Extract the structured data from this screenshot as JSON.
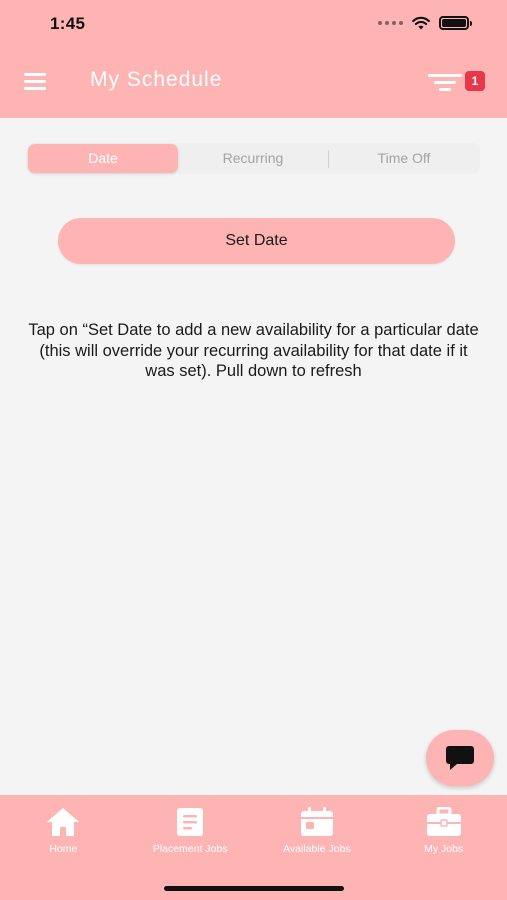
{
  "status_bar": {
    "time": "1:45"
  },
  "header": {
    "title": "My Schedule",
    "notification_count": "1"
  },
  "tabs": [
    {
      "label": "Date",
      "active": true
    },
    {
      "label": "Recurring",
      "active": false
    },
    {
      "label": "Time Off",
      "active": false
    }
  ],
  "set_date_button": {
    "label": "Set Date"
  },
  "help_text": "Tap on “Set Date to add a new availability for a particular date (this will override your recurring availability for that date if it was set). Pull down to refresh",
  "bottom_nav": [
    {
      "label": "Home",
      "icon": "home-icon"
    },
    {
      "label": "Placement Jobs",
      "icon": "document-icon"
    },
    {
      "label": "Available Jobs",
      "icon": "calendar-icon"
    },
    {
      "label": "My Jobs",
      "icon": "briefcase-icon"
    }
  ],
  "chat_button": {
    "icon": "chat-icon"
  },
  "colors": {
    "primary": "#ffb4b4",
    "badge": "#e8364a",
    "background": "#f4f4f4"
  }
}
